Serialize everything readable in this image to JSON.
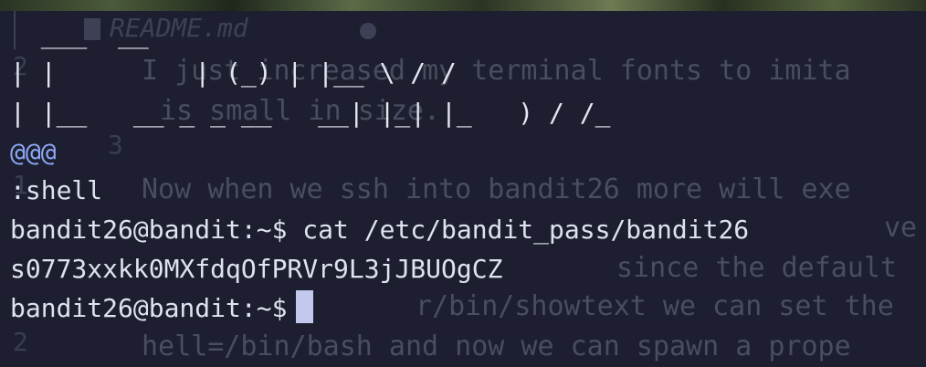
{
  "editor_background": {
    "file_title": "README.md",
    "lines": [
      {
        "num": "2",
        "text": "I just increased my terminal fonts to imita"
      },
      {
        "num": "",
        "text": "is small in size."
      },
      {
        "num": "3",
        "text": ""
      },
      {
        "num": "1",
        "text": "Now when we ssh into bandit26 more will exe"
      },
      {
        "num": "",
        "text": "ve"
      },
      {
        "num": "",
        "text": "since the default"
      },
      {
        "num": "",
        "text": "r/bin/showtext we can set the"
      },
      {
        "num": "2",
        "text": "hell=/bin/bash and now we can spawn a prope"
      }
    ]
  },
  "terminal": {
    "ascii_art": [
      "  ___  __",
      "| |         | (_) | |__ \\ / /",
      "| |__   __ _ _ __   __| |_| |_   ) / /_"
    ],
    "prompt_marker": "@@@",
    "mode": ":shell",
    "prompt": "bandit26@bandit:~$",
    "command": "cat /etc/bandit_pass/bandit26",
    "output": "s0773xxkk0MXfdqOfPRVr9L3jJBUOgCZ"
  },
  "colors": {
    "background": "#1d1f30",
    "text": "#dfe2f0",
    "marker": "#8ea6f5",
    "cursor": "#c3c8ef",
    "faded_text": "#4a4c60"
  }
}
